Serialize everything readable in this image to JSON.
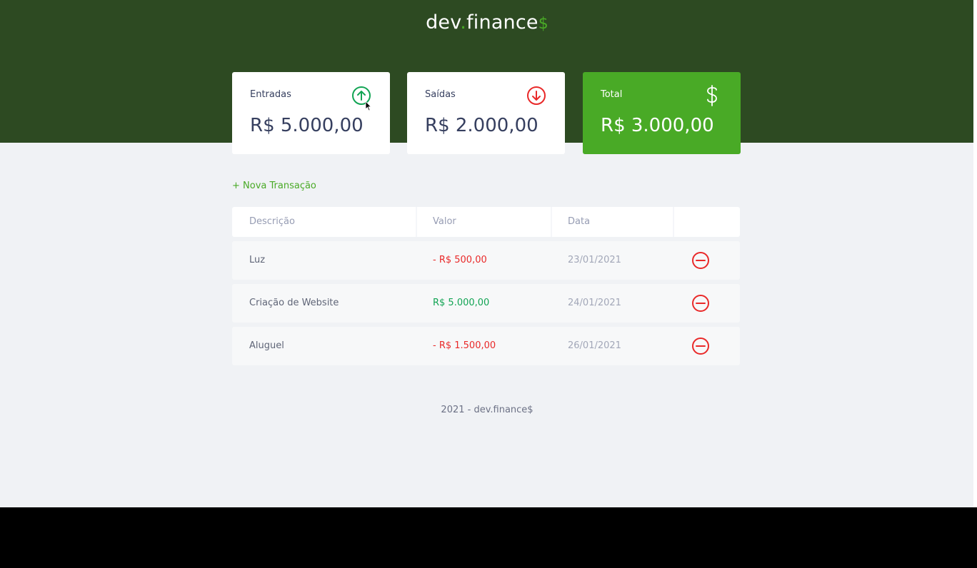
{
  "header": {
    "logo_main": "dev",
    "logo_dot": ".",
    "logo_name": "finance",
    "logo_symbol": "$"
  },
  "balance": {
    "income": {
      "title": "Entradas",
      "value": "R$ 5.000,00",
      "icon": "arrow-up-circle-icon"
    },
    "expense": {
      "title": "Saídas",
      "value": "R$ 2.000,00",
      "icon": "arrow-down-circle-icon"
    },
    "total": {
      "title": "Total",
      "value": "R$ 3.000,00",
      "icon": "dollar-icon"
    }
  },
  "actions": {
    "new_transaction": "+ Nova Transação"
  },
  "table": {
    "headers": [
      "Descrição",
      "Valor",
      "Data",
      ""
    ],
    "rows": [
      {
        "description": "Luz",
        "amount": "- R$ 500,00",
        "type": "expense",
        "date": "23/01/2021",
        "remove_icon": "minus-circle-icon"
      },
      {
        "description": "Criação de Website",
        "amount": "R$ 5.000,00",
        "type": "income",
        "date": "24/01/2021",
        "remove_icon": "minus-circle-icon"
      },
      {
        "description": "Aluguel",
        "amount": "- R$ 1.500,00",
        "type": "expense",
        "date": "26/01/2021",
        "remove_icon": "minus-circle-icon"
      }
    ]
  },
  "footer": {
    "text": "2021 - dev.finance$"
  },
  "colors": {
    "header_bg": "#2d4a22",
    "accent": "#49aa26",
    "income": "#12a454",
    "expense": "#e92929",
    "page_bg": "#f0f2f5"
  }
}
